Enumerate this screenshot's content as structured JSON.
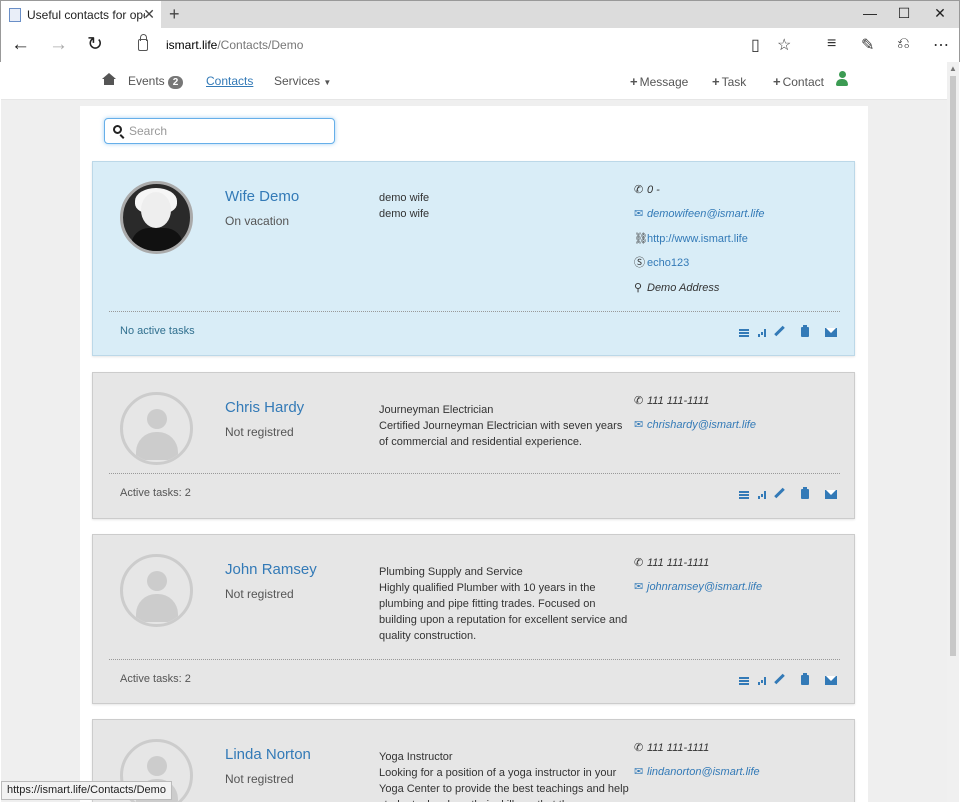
{
  "browser": {
    "tab_title": "Useful contacts for oper",
    "new_tab": "+",
    "url_host": "ismart.life",
    "url_path": "/Contacts/Demo",
    "status_url": "https://ismart.life/Contacts/Demo"
  },
  "nav": {
    "events_label": "Events",
    "events_count": "2",
    "contacts_label": "Contacts",
    "services_label": "Services",
    "message_label": "Message",
    "task_label": "Task",
    "contact_label": "Contact"
  },
  "search": {
    "placeholder": "Search"
  },
  "contacts": [
    {
      "name": "Wife Demo",
      "status": "On vacation",
      "title": "demo wife",
      "description": "demo wife",
      "phone": "0 -",
      "email": "demowifeen@ismart.life",
      "website": "http://www.ismart.life",
      "skype": "echo123",
      "address": "Demo Address",
      "tasks": "No active tasks"
    },
    {
      "name": "Chris Hardy",
      "status": "Not registred",
      "title": "Journeyman Electrician",
      "description": "Certified Journeyman Electrician with seven years of commercial and residential experience.",
      "phone": "111 111-1111",
      "email": "chrishardy@ismart.life",
      "tasks": "Active tasks: 2"
    },
    {
      "name": "John Ramsey",
      "status": "Not registred",
      "title": "Plumbing Supply and Service",
      "description": "Highly qualified Plumber with 10 years in the plumbing and pipe fitting trades. Focused on building upon a reputation for excellent service and quality construction.",
      "phone": "111 111-1111",
      "email": "johnramsey@ismart.life",
      "tasks": "Active tasks: 2"
    },
    {
      "name": "Linda Norton",
      "status": "Not registred",
      "title": "Yoga Instructor",
      "description": "Looking for a position of a yoga instructor in your Yoga Center to provide the best teachings and help students develope their skills so that they",
      "phone": "111 111-1111",
      "email": "lindanorton@ismart.life"
    }
  ],
  "colors": {
    "accent": "#337ab7",
    "highlight_card": "#d9edf7",
    "card": "#e6e6e6",
    "user_icon": "#3c9b53"
  }
}
